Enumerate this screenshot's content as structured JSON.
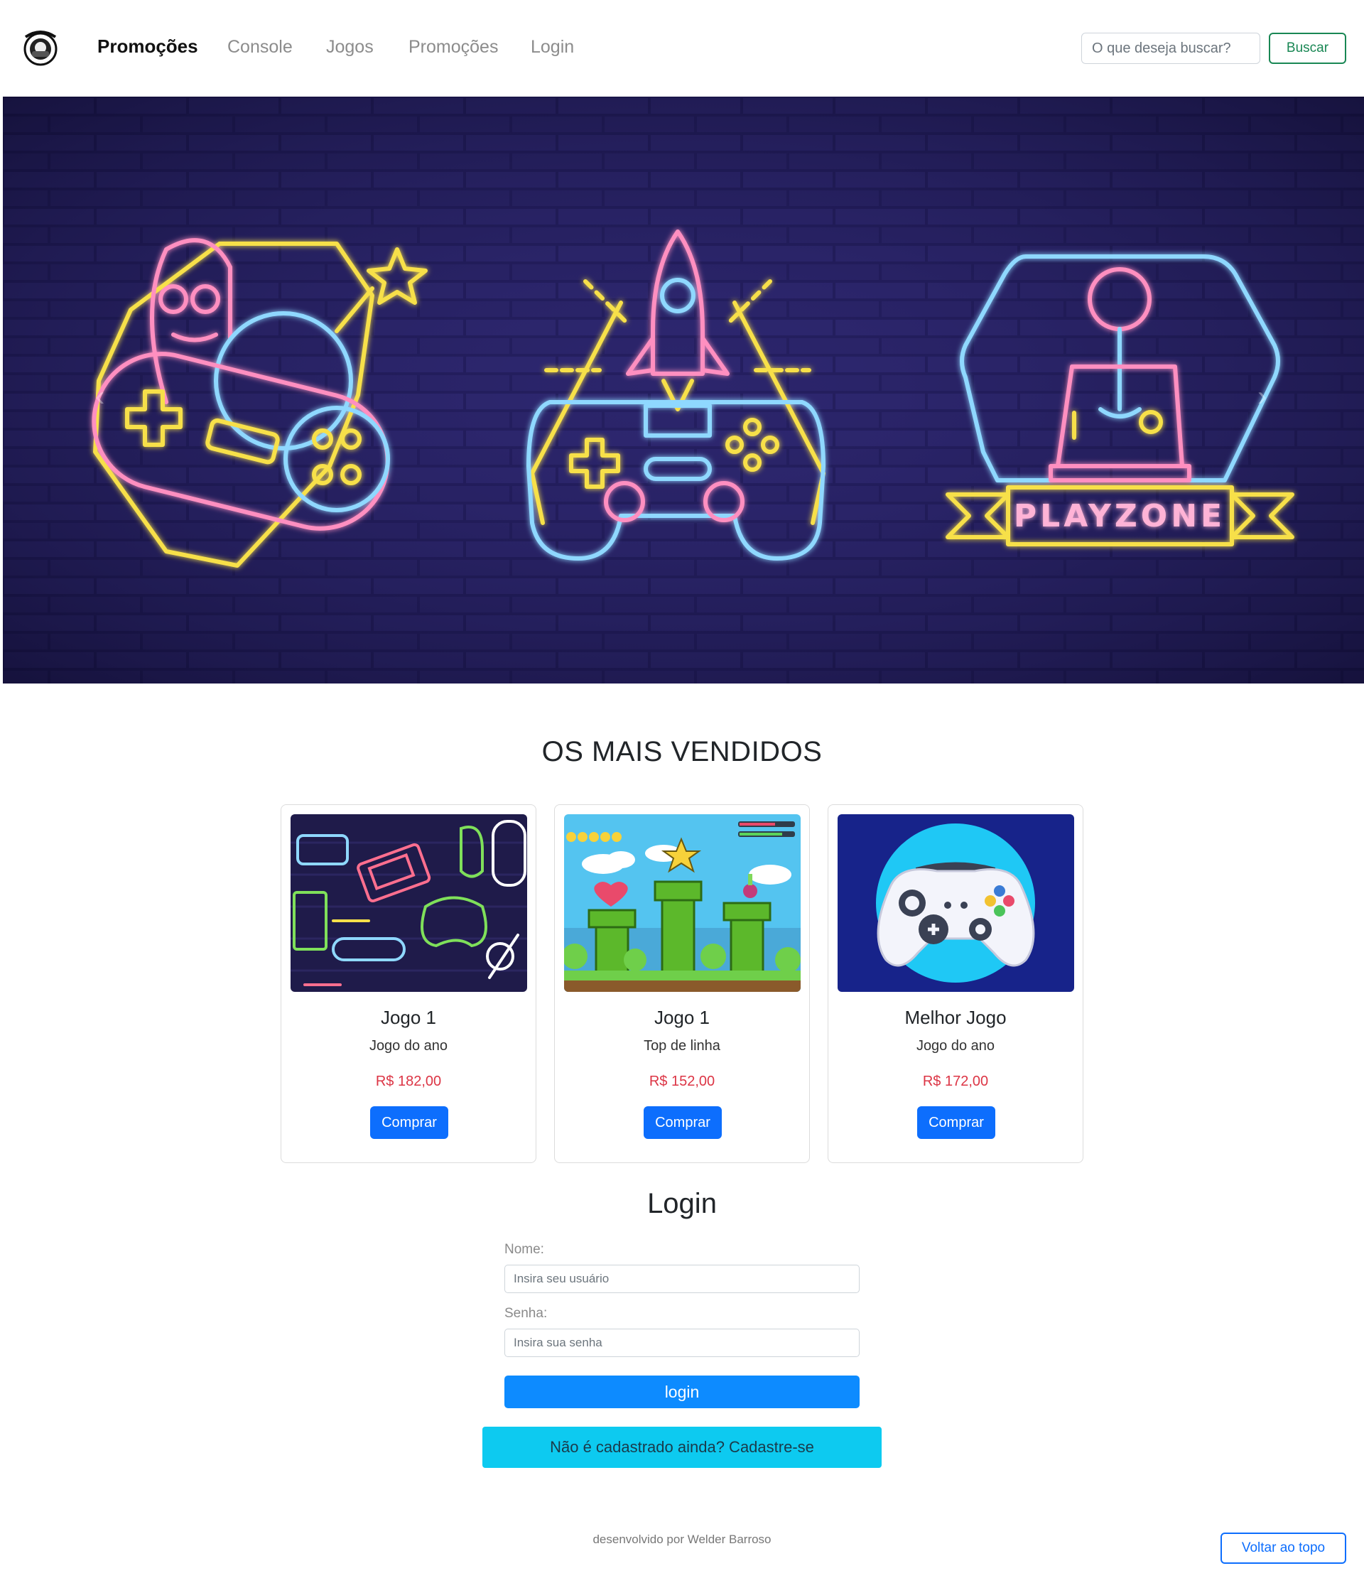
{
  "navbar": {
    "brand": "Promoções",
    "links": [
      "Console",
      "Jogos",
      "Promoções",
      "Login"
    ],
    "search_placeholder": "O que deseja buscar?",
    "search_button": "Buscar"
  },
  "hero": {
    "sign_text": "PLAYZONE",
    "prev_icon": "chevron-left-icon",
    "next_icon": "chevron-right-icon"
  },
  "bestsellers": {
    "title": "OS MAIS VENDIDOS",
    "cards": [
      {
        "title": "Jogo 1",
        "subtitle": "Jogo do ano",
        "price": "R$ 182,00",
        "button": "Comprar"
      },
      {
        "title": "Jogo 1",
        "subtitle": "Top de linha",
        "price": "R$ 152,00",
        "button": "Comprar"
      },
      {
        "title": "Melhor Jogo",
        "subtitle": "Jogo do ano",
        "price": "R$ 172,00",
        "button": "Comprar"
      }
    ]
  },
  "login": {
    "title": "Login",
    "name_label": "Nome:",
    "name_placeholder": "Insira seu usuário",
    "password_label": "Senha:",
    "password_placeholder": "Insira sua senha",
    "submit": "login",
    "register": "Não é cadastrado ainda? Cadastre-se"
  },
  "footer": {
    "credit": "desenvolvido por Welder Barroso",
    "back_to_top": "Voltar ao topo"
  },
  "colors": {
    "primary": "#0d6efd",
    "success": "#198754",
    "danger": "#dc3545",
    "info": "#0dcaf0"
  }
}
